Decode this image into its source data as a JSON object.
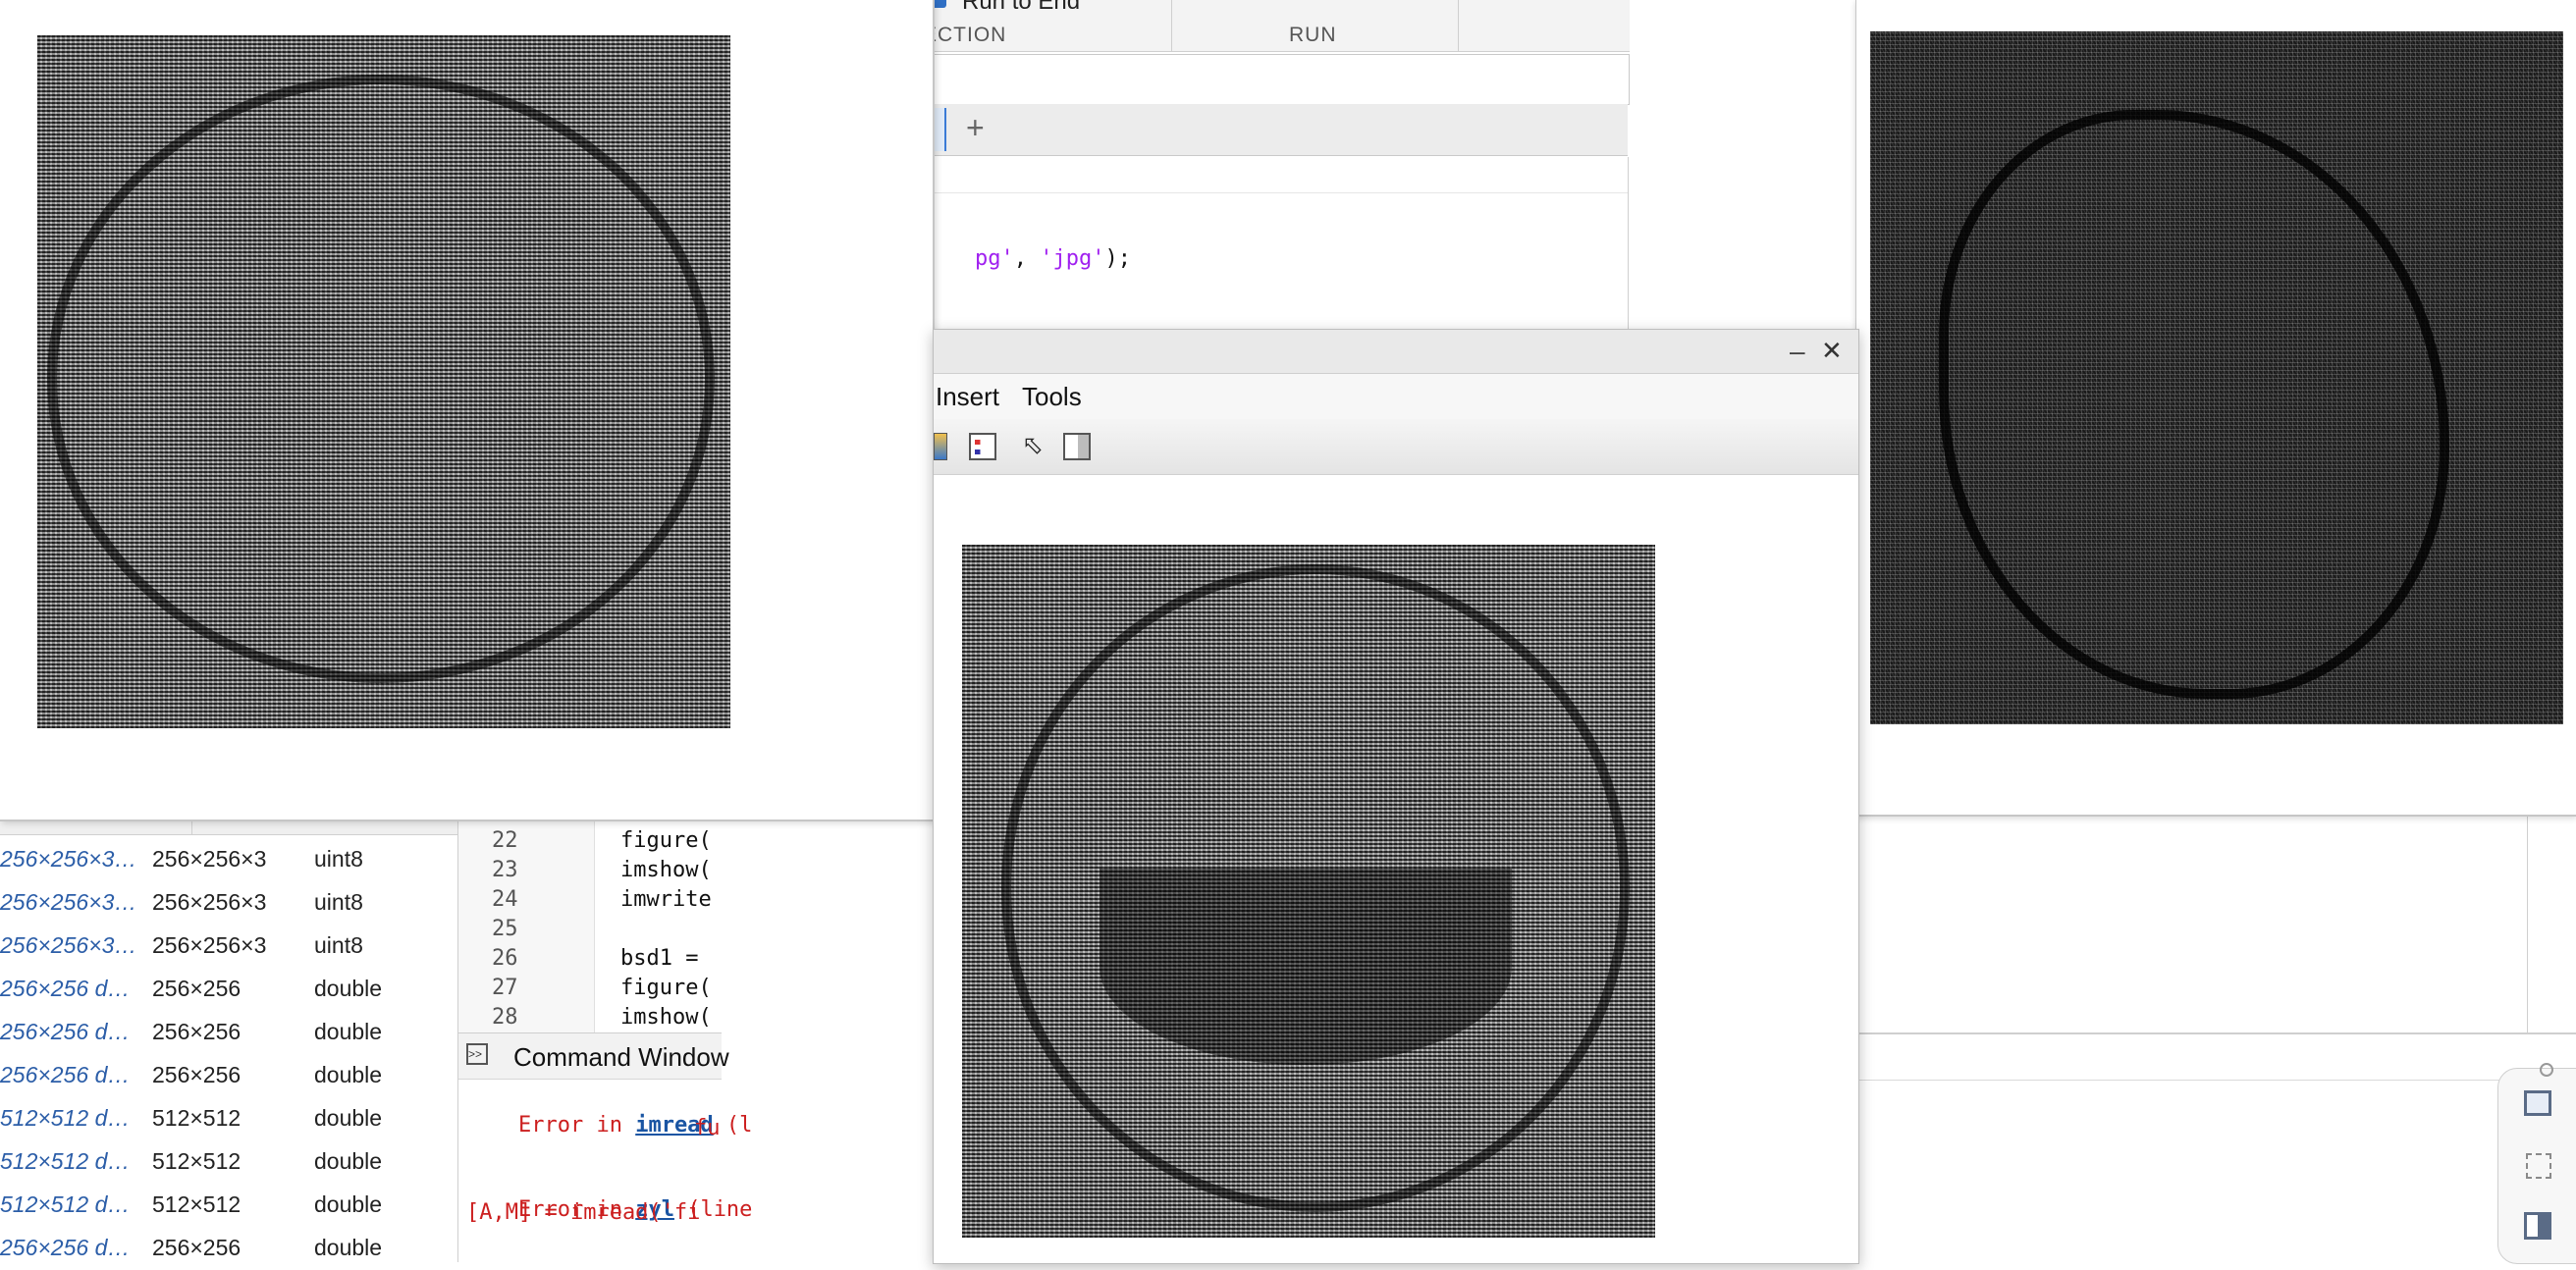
{
  "toolstrip": {
    "run_to_end": "Run to End",
    "section_label": "ECTION",
    "run_label": "RUN"
  },
  "editor": {
    "add_tab": "+",
    "top_code": {
      "a": "pg'",
      "b": ", ",
      "c": "'jpg'",
      "d": ");"
    },
    "lines": [
      {
        "n": "22",
        "code": "figure("
      },
      {
        "n": "23",
        "code": "imshow("
      },
      {
        "n": "24",
        "code": "imwrite"
      },
      {
        "n": "25",
        "code": ""
      },
      {
        "n": "26",
        "code": "bsd1 = "
      },
      {
        "n": "27",
        "code": "figure("
      },
      {
        "n": "28",
        "code": "imshow("
      }
    ]
  },
  "figure_window": {
    "menu": [
      "Insert",
      "Tools"
    ],
    "minimize": "–",
    "close": "✕"
  },
  "workspace": {
    "rows": [
      {
        "value": "256×256×3…",
        "size": "256×256×3",
        "class": "uint8"
      },
      {
        "value": "256×256×3…",
        "size": "256×256×3",
        "class": "uint8"
      },
      {
        "value": "256×256×3…",
        "size": "256×256×3",
        "class": "uint8"
      },
      {
        "value": "256×256 d…",
        "size": "256×256",
        "class": "double"
      },
      {
        "value": "256×256 d…",
        "size": "256×256",
        "class": "double"
      },
      {
        "value": "256×256 d…",
        "size": "256×256",
        "class": "double"
      },
      {
        "value": "512×512 d…",
        "size": "512×512",
        "class": "double"
      },
      {
        "value": "512×512 d…",
        "size": "512×512",
        "class": "double"
      },
      {
        "value": "512×512 d…",
        "size": "512×512",
        "class": "double"
      },
      {
        "value": "256×256 d…",
        "size": "256×256",
        "class": "double"
      }
    ]
  },
  "command_window": {
    "title": "Command Window",
    "err1_prefix": "Error in ",
    "err1_fn": "imread",
    "err1_rest": " (l",
    "err1_cont": "fu",
    "err2_prefix": "Error in ",
    "err2_fn": "zyl",
    "err2_rest": " (line",
    "err2_code": "[A,M] = imread('fi"
  },
  "colors": {
    "error_red": "#cc1f1f",
    "link_blue": "#1a55a3",
    "string_purple": "#a020f0",
    "workspace_italic_blue": "#2c5ea8"
  }
}
